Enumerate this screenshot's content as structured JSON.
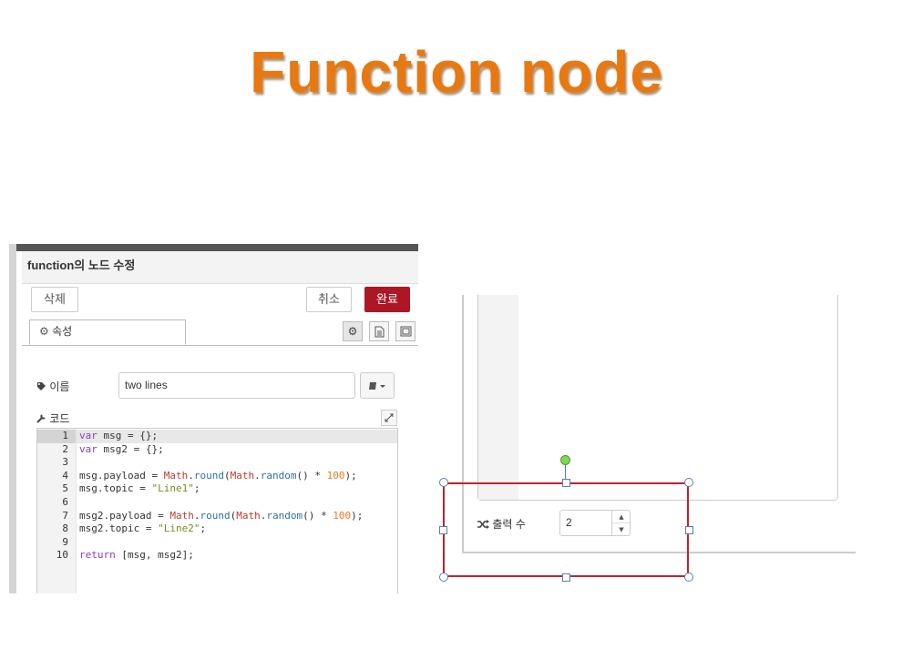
{
  "slide": {
    "title": "Function node"
  },
  "panel": {
    "header_title": "function의 노드 수정",
    "buttons": {
      "delete": "삭제",
      "cancel": "취소",
      "done": "완료"
    },
    "tab_properties": "속성",
    "name_label": "이름",
    "name_value": "two lines",
    "code_label": "코드",
    "code_lines": [
      {
        "no": "1",
        "text": "var msg = {};"
      },
      {
        "no": "2",
        "text": "var msg2 = {};"
      },
      {
        "no": "3",
        "text": ""
      },
      {
        "no": "4",
        "text": "msg.payload = Math.round(Math.random() * 100);"
      },
      {
        "no": "5",
        "text": "msg.topic = \"Line1\";"
      },
      {
        "no": "6",
        "text": ""
      },
      {
        "no": "7",
        "text": "msg2.payload = Math.round(Math.random() * 100);"
      },
      {
        "no": "8",
        "text": "msg2.topic = \"Line2\";"
      },
      {
        "no": "9",
        "text": ""
      },
      {
        "no": "10",
        "text": "return [msg, msg2];"
      }
    ]
  },
  "outputs": {
    "label": "출력 수",
    "value": "2"
  },
  "colors": {
    "title": "#e8780f",
    "done_button": "#ad1625",
    "selection": "#c0232c",
    "rotate_handle": "#7ed957"
  },
  "icons": [
    "gear-icon",
    "document-icon",
    "layout-icon",
    "tag-icon",
    "wrench-icon",
    "book-icon",
    "expand-icon",
    "shuffle-icon"
  ]
}
